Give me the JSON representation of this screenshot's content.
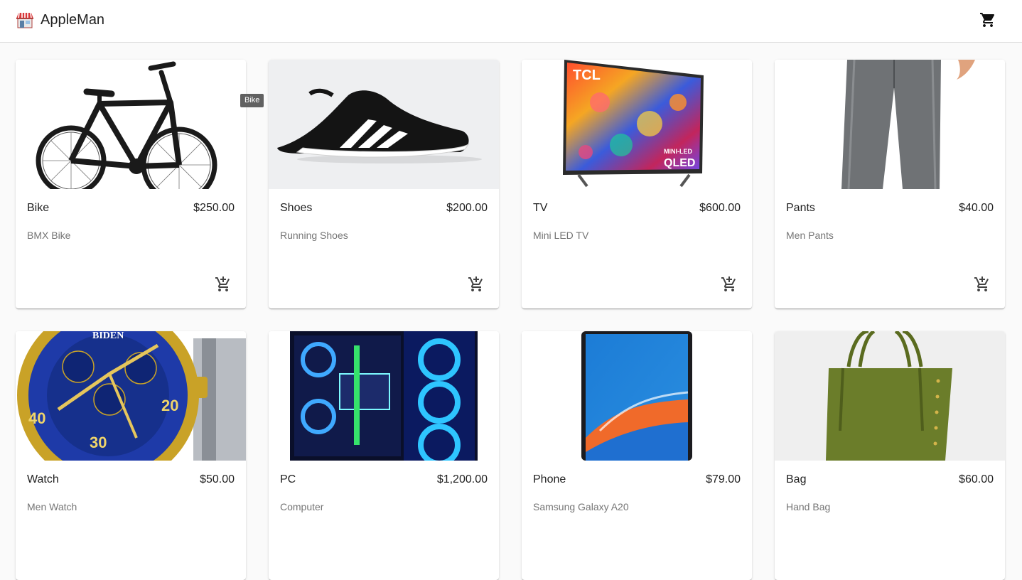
{
  "app": {
    "brand": "AppleMan",
    "logo_icon": "storefront-icon",
    "cart_icon": "shopping-cart-icon"
  },
  "tooltip": {
    "text": "Bike"
  },
  "products": [
    {
      "name": "Bike",
      "price": "$250.00",
      "description": "BMX Bike"
    },
    {
      "name": "Shoes",
      "price": "$200.00",
      "description": "Running Shoes"
    },
    {
      "name": "TV",
      "price": "$600.00",
      "description": "Mini LED TV"
    },
    {
      "name": "Pants",
      "price": "$40.00",
      "description": "Men Pants"
    },
    {
      "name": "Watch",
      "price": "$50.00",
      "description": "Men Watch"
    },
    {
      "name": "PC",
      "price": "$1,200.00",
      "description": "Computer"
    },
    {
      "name": "Phone",
      "price": "$79.00",
      "description": "Samsung Galaxy A20"
    },
    {
      "name": "Bag",
      "price": "$60.00",
      "description": "Hand Bag"
    }
  ],
  "images": {
    "tv_brand": "TCL",
    "tv_badge_line1": "MINI-LED",
    "tv_badge_line2": "QLED",
    "watch_brand": "BIDEN",
    "watch_bezel_40": "40",
    "watch_bezel_20": "20",
    "watch_bezel_30": "30"
  },
  "colors": {
    "accent": "#212121",
    "muted": "#757575",
    "appbar": "#ffffff"
  }
}
